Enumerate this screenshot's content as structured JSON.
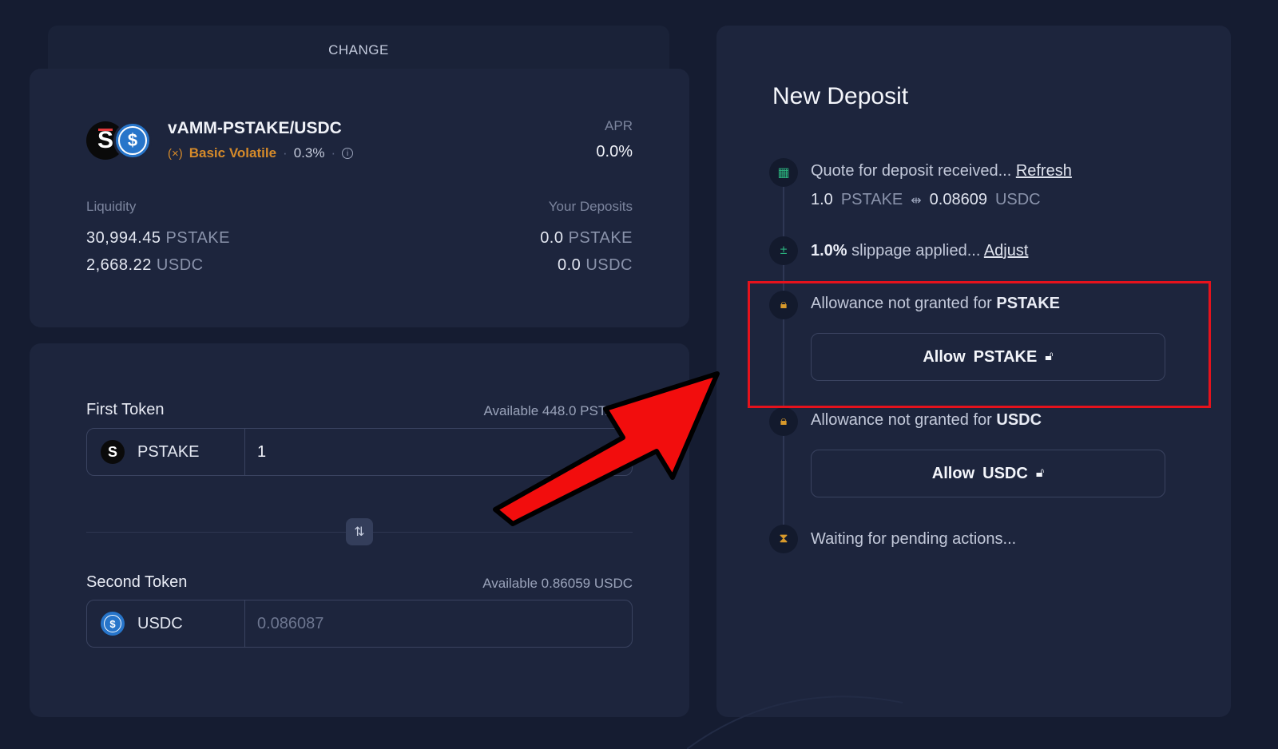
{
  "change_tab": {
    "label": "CHANGE"
  },
  "pool": {
    "name": "vAMM-PSTAKE/USDC",
    "type": "Basic Volatile",
    "fee": "0.3%",
    "apr_label": "APR",
    "apr_value": "0.0%",
    "liquidity_label": "Liquidity",
    "deposits_label": "Your Deposits",
    "liquidity": [
      {
        "amount": "30,994.45",
        "unit": "PSTAKE"
      },
      {
        "amount": "2,668.22",
        "unit": "USDC"
      }
    ],
    "deposits": [
      {
        "amount": "0.0",
        "unit": "PSTAKE"
      },
      {
        "amount": "0.0",
        "unit": "USDC"
      }
    ]
  },
  "first_token": {
    "label": "First Token",
    "available": "Available 448.0 PSTAKE",
    "symbol": "PSTAKE",
    "value": "1"
  },
  "second_token": {
    "label": "Second Token",
    "available": "Available 0.86059 USDC",
    "symbol": "USDC",
    "value": "0.086087"
  },
  "deposit": {
    "title": "New Deposit",
    "quote_text": "Quote for deposit received...",
    "refresh_label": "Refresh",
    "quote_from_amount": "1.0",
    "quote_from_unit": "PSTAKE",
    "quote_to_amount": "0.08609",
    "quote_to_unit": "USDC",
    "slippage_value": "1.0%",
    "slippage_text": "slippage applied...",
    "adjust_label": "Adjust",
    "allowance_text": "Allowance not granted for",
    "allowance_pstake_token": "PSTAKE",
    "allowance_usdc_token": "USDC",
    "allow_label": "Allow",
    "allow_pstake_token": "PSTAKE",
    "allow_usdc_token": "USDC",
    "waiting_text": "Waiting for pending actions..."
  },
  "colors": {
    "background": "#151c31",
    "card": "#1d253d",
    "accent_orange": "#d58a2a",
    "accent_green": "#2bb37e",
    "highlight_red": "#e5121c"
  },
  "icons": {
    "pstake": "pstake-token-icon",
    "usdc": "usdc-token-icon",
    "quote": "table-icon",
    "slippage": "plus-minus-icon",
    "allowance": "lock-icon",
    "waiting": "hourglass-icon",
    "swap": "swap-arrows-icon"
  }
}
